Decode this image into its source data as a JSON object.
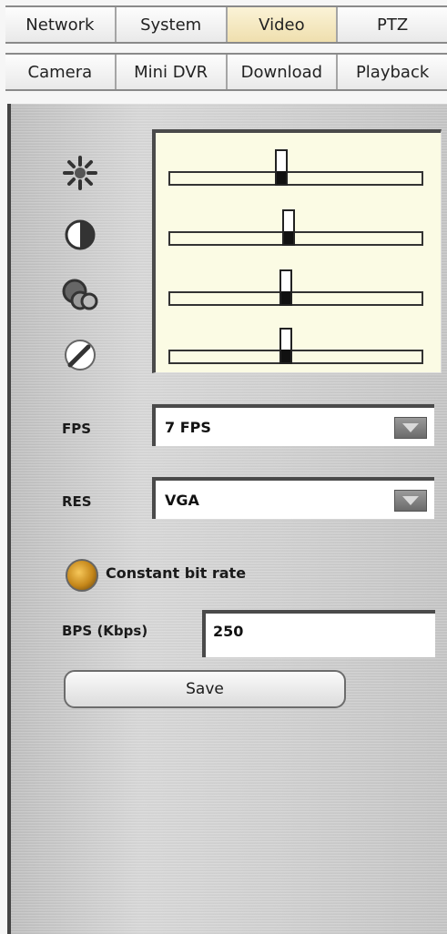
{
  "tabs_primary": [
    "Network",
    "System",
    "Video",
    "PTZ"
  ],
  "tabs_secondary": [
    "Camera",
    "Mini DVR",
    "Download",
    "Playback"
  ],
  "active_tab": "Video",
  "sliders": [
    {
      "name": "brightness",
      "icon": "brightness-icon",
      "value": 0.44
    },
    {
      "name": "contrast",
      "icon": "contrast-icon",
      "value": 0.47
    },
    {
      "name": "saturation",
      "icon": "saturation-icon",
      "value": 0.46
    },
    {
      "name": "sharpness",
      "icon": "sharpness-icon",
      "value": 0.46
    }
  ],
  "fps": {
    "label": "FPS",
    "value": "7 FPS"
  },
  "res": {
    "label": "RES",
    "value": "VGA"
  },
  "constant_bit_rate": {
    "label": "Constant bit rate",
    "selected": true
  },
  "bps": {
    "label": "BPS (Kbps)",
    "value": "250"
  },
  "save_label": "Save",
  "colors": {
    "active_tab": "#f4e6b9",
    "slider_bg": "#fbfbe4",
    "radio": "#d99a22"
  }
}
